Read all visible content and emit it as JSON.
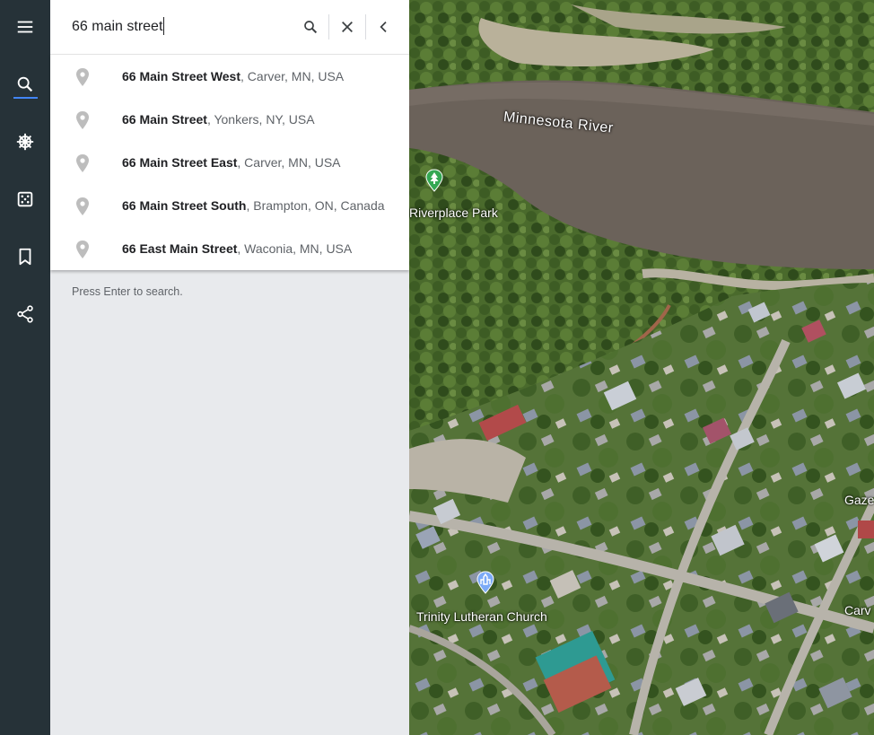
{
  "rail": {
    "items": [
      "menu",
      "search",
      "voyager",
      "feeling-lucky",
      "projects",
      "share"
    ]
  },
  "search": {
    "query": "66 main street",
    "placeholder": ""
  },
  "suggestions": [
    {
      "bold": "66 Main Street West",
      "rest": ", Carver, MN, USA"
    },
    {
      "bold": "66 Main Street",
      "rest": ", Yonkers, NY, USA"
    },
    {
      "bold": "66 Main Street East",
      "rest": ", Carver, MN, USA"
    },
    {
      "bold": "66 Main Street South",
      "rest": ", Brampton, ON, Canada"
    },
    {
      "bold": "66 East Main Street",
      "rest": ", Waconia, MN, USA"
    }
  ],
  "hint": "Press Enter to search.",
  "map": {
    "labels": {
      "river": "Minnesota River",
      "park": "Riverplace Park",
      "church": "Trinity Lutheran Church",
      "gaze": "Gaze",
      "carv": "Carv"
    }
  },
  "colors": {
    "rail": "#263238",
    "accent": "#4285f4",
    "park_marker": "#34a853",
    "church_marker": "#7baaf7"
  }
}
